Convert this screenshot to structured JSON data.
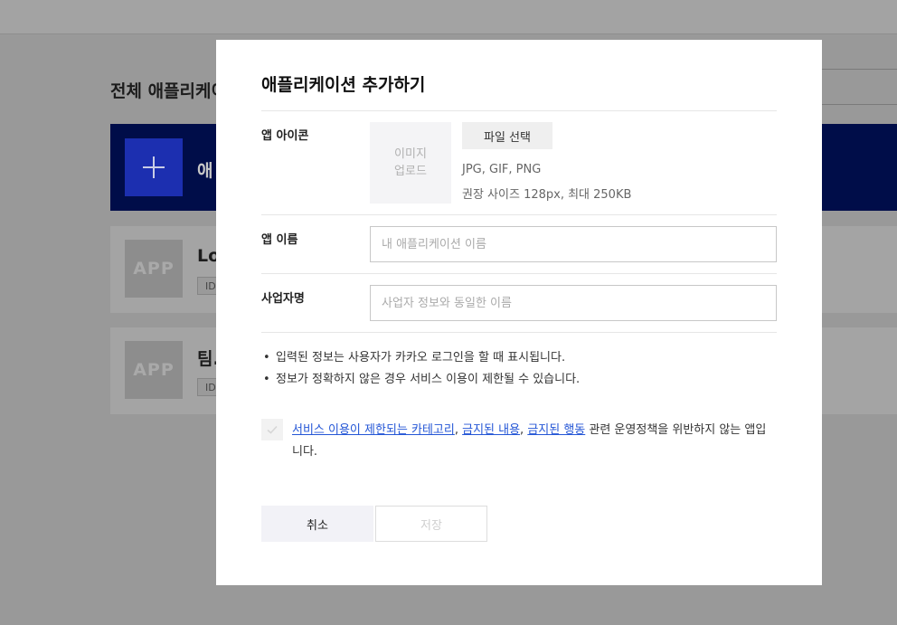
{
  "background": {
    "page_title": "전체 애플리케이",
    "add_card_label": "애",
    "apps": [
      {
        "thumb": "APP",
        "name": "Lo",
        "id_badge": "ID"
      },
      {
        "thumb": "APP",
        "name": "팀.",
        "id_badge": "ID"
      }
    ]
  },
  "modal": {
    "title": "애플리케이션 추가하기",
    "icon_row": {
      "label": "앱 아이콘",
      "upload_line1": "이미지",
      "upload_line2": "업로드",
      "file_button": "파일 선택",
      "hint_formats": "JPG, GIF, PNG",
      "hint_size": "권장 사이즈 128px, 최대 250KB"
    },
    "name_row": {
      "label": "앱 이름",
      "placeholder": "내 애플리케이션 이름",
      "value": ""
    },
    "company_row": {
      "label": "사업자명",
      "placeholder": "사업자 정보와 동일한 이름",
      "value": ""
    },
    "notices": [
      "입력된 정보는 사용자가 카카오 로그인을 할 때 표시됩니다.",
      "정보가 정확하지 않은 경우 서비스 이용이 제한될 수 있습니다."
    ],
    "agreement": {
      "link1": "서비스 이용이 제한되는 카테고리",
      "sep1": ", ",
      "link2": "금지된 내용",
      "sep2": ", ",
      "link3": "금지된 행동",
      "text": " 관련 운영정책을 위반하지 않는 앱입니다.",
      "checked": false
    },
    "buttons": {
      "cancel": "취소",
      "save": "저장"
    }
  },
  "colors": {
    "overlay": "#999999",
    "accent_navy": "#000d49",
    "plus_blue": "#1c2fb0",
    "link_blue": "#2456d6"
  }
}
